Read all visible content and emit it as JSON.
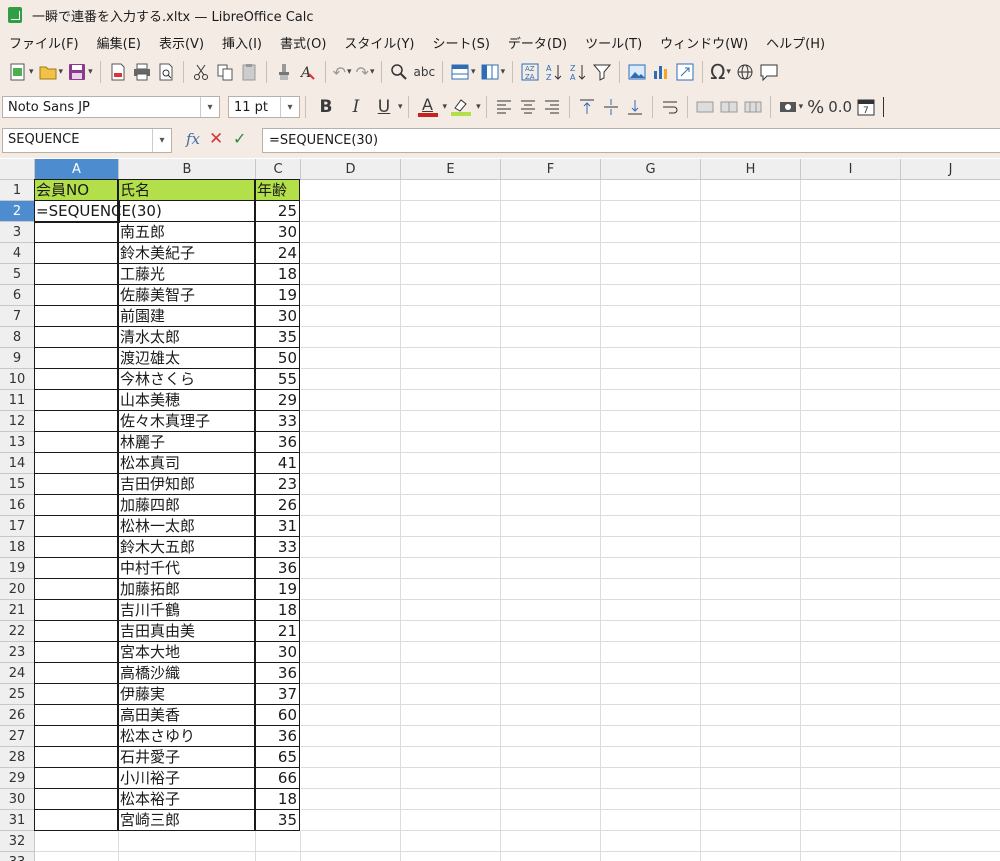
{
  "window": {
    "title": "一瞬で連番を入力する.xltx — LibreOffice Calc"
  },
  "menu": [
    "ファイル(F)",
    "編集(E)",
    "表示(V)",
    "挿入(I)",
    "書式(O)",
    "スタイル(Y)",
    "シート(S)",
    "データ(D)",
    "ツール(T)",
    "ウィンドウ(W)",
    "ヘルプ(H)"
  ],
  "format_bar": {
    "font_name": "Noto Sans JP",
    "font_size": "11 pt",
    "bold": "B",
    "italic": "I",
    "underline": "U",
    "font_color_glyph": "A",
    "percent": "%",
    "decimal": "0.0"
  },
  "formula_bar": {
    "name_box": "SEQUENCE",
    "fx": "fx",
    "formula": "=SEQUENCE(30)"
  },
  "columns": [
    "A",
    "B",
    "C",
    "D",
    "E",
    "F",
    "G",
    "H",
    "I",
    "J"
  ],
  "rows": [
    "1",
    "2",
    "3",
    "4",
    "5",
    "6",
    "7",
    "8",
    "9",
    "10",
    "11",
    "12",
    "13",
    "14",
    "15",
    "16",
    "17",
    "18",
    "19",
    "20",
    "21",
    "22",
    "23",
    "24",
    "25",
    "26",
    "27",
    "28",
    "29",
    "30",
    "31",
    "32",
    "33"
  ],
  "sheet": {
    "headers": {
      "a": "会員NO",
      "b": "氏名",
      "c": "年齢"
    },
    "editing_cell_text": "=SEQUENCE(30)",
    "records": [
      {
        "name": "",
        "age": "25"
      },
      {
        "name": "南五郎",
        "age": "30"
      },
      {
        "name": "鈴木美紀子",
        "age": "24"
      },
      {
        "name": "工藤光",
        "age": "18"
      },
      {
        "name": "佐藤美智子",
        "age": "19"
      },
      {
        "name": "前園建",
        "age": "30"
      },
      {
        "name": "清水太郎",
        "age": "35"
      },
      {
        "name": "渡辺雄太",
        "age": "50"
      },
      {
        "name": "今林さくら",
        "age": "55"
      },
      {
        "name": "山本美穂",
        "age": "29"
      },
      {
        "name": "佐々木真理子",
        "age": "33"
      },
      {
        "name": "林麗子",
        "age": "36"
      },
      {
        "name": "松本真司",
        "age": "41"
      },
      {
        "name": "吉田伊知郎",
        "age": "23"
      },
      {
        "name": "加藤四郎",
        "age": "26"
      },
      {
        "name": "松林一太郎",
        "age": "31"
      },
      {
        "name": "鈴木大五郎",
        "age": "33"
      },
      {
        "name": "中村千代",
        "age": "36"
      },
      {
        "name": "加藤拓郎",
        "age": "19"
      },
      {
        "name": "吉川千鶴",
        "age": "18"
      },
      {
        "name": "吉田真由美",
        "age": "21"
      },
      {
        "name": "宮本大地",
        "age": "30"
      },
      {
        "name": "高橋沙織",
        "age": "36"
      },
      {
        "name": "伊藤実",
        "age": "37"
      },
      {
        "name": "高田美香",
        "age": "60"
      },
      {
        "name": "松本さゆり",
        "age": "36"
      },
      {
        "name": "石井愛子",
        "age": "65"
      },
      {
        "name": "小川裕子",
        "age": "66"
      },
      {
        "name": "松本裕子",
        "age": "18"
      },
      {
        "name": "宮崎三郎",
        "age": "35"
      }
    ]
  },
  "colors": {
    "header_fill": "#b3e04a",
    "selection": "#4d8ccf",
    "chrome": "#f4ebe5"
  }
}
